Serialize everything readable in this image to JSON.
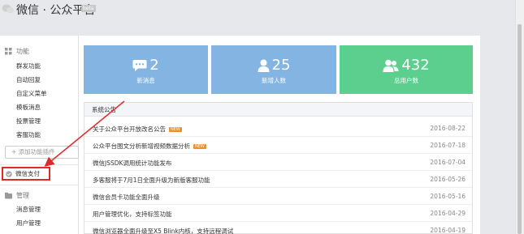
{
  "header": {
    "brand": "微信 · 公众平台",
    "badge": "beta"
  },
  "sidebar": {
    "function_section": "功能",
    "function_items": [
      "群发功能",
      "自动回复",
      "自定义菜单",
      "模板消息",
      "投票管理",
      "客服功能"
    ],
    "add_function": "+ 添加功能插件",
    "wechat_pay": "微信支付",
    "manage_section": "管理",
    "manage_items": [
      "消息管理",
      "用户管理"
    ]
  },
  "stats": [
    {
      "value": "2",
      "label": "新消息",
      "icon": "chat-icon"
    },
    {
      "value": "25",
      "label": "新增人数",
      "icon": "person-icon"
    },
    {
      "value": "432",
      "label": "总用户数",
      "icon": "users-icon"
    }
  ],
  "notice": {
    "title": "系统公告",
    "new_label": "NEW",
    "items": [
      {
        "title": "关于公众平台开放改名公告",
        "new": true,
        "date": "2016-08-22"
      },
      {
        "title": "公众平台图文分析新增视频数据分析",
        "new": true,
        "date": "2016-07-18"
      },
      {
        "title": "微信JSSDK调用统计功能发布",
        "new": false,
        "date": "2016-07-04"
      },
      {
        "title": "多客服将于7月1日全面升级为新版客服功能",
        "new": false,
        "date": "2016-05-26"
      },
      {
        "title": "微信会员卡功能全面升级",
        "new": false,
        "date": "2016-05-16"
      },
      {
        "title": "用户管理优化，支持标签功能",
        "new": false,
        "date": "2016-04-29"
      },
      {
        "title": "微信浏览器全面升级至X5 Blink内核，支持远程调试",
        "new": false,
        "date": "2016-04-19"
      }
    ]
  },
  "colors": {
    "stat_blue": "#84b4e2",
    "stat_green": "#5ccf8f",
    "highlight_red": "#e02a2a",
    "new_badge": "#f28d2b"
  }
}
